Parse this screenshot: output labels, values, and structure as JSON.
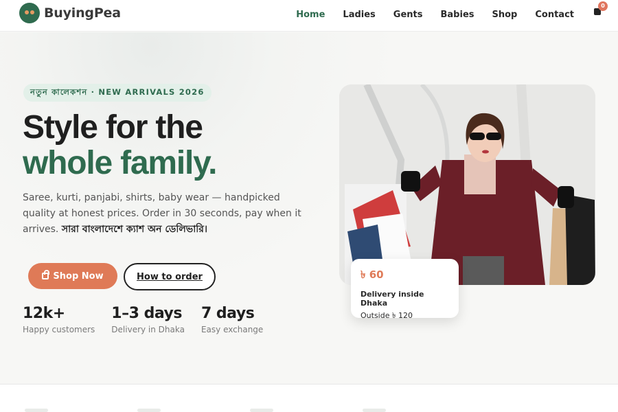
{
  "brand": {
    "name": "BuyingPea"
  },
  "nav": {
    "items": [
      "Home",
      "Ladies",
      "Gents",
      "Babies",
      "Shop",
      "Contact"
    ],
    "active": "Home"
  },
  "cart": {
    "count": "0"
  },
  "hero": {
    "pill": "নতুন কালেকশন · NEW ARRIVALS 2026",
    "headline_line1": "Style for the",
    "headline_line2": "whole family.",
    "description_en": "Saree, kurti, panjabi, shirts, baby wear — handpicked quality at honest prices. Order in 30 seconds, pay when it arrives.",
    "description_bn": "সারা বাংলাদেশে ক্যাশ অন ডেলিভারি।",
    "primary_button": "Shop Now",
    "secondary_button": "How to order"
  },
  "stats": [
    {
      "value": "12k+",
      "label": "Happy customers"
    },
    {
      "value": "1–3 days",
      "label": "Delivery in Dhaka"
    },
    {
      "value": "7 days",
      "label": "Easy exchange"
    }
  ],
  "delivery_card": {
    "price": "৳ 60",
    "line1": "Delivery inside Dhaka",
    "line2": "Outside ৳ 120"
  },
  "colors": {
    "accent_green": "#2f6b4f",
    "accent_orange": "#df7a57"
  }
}
